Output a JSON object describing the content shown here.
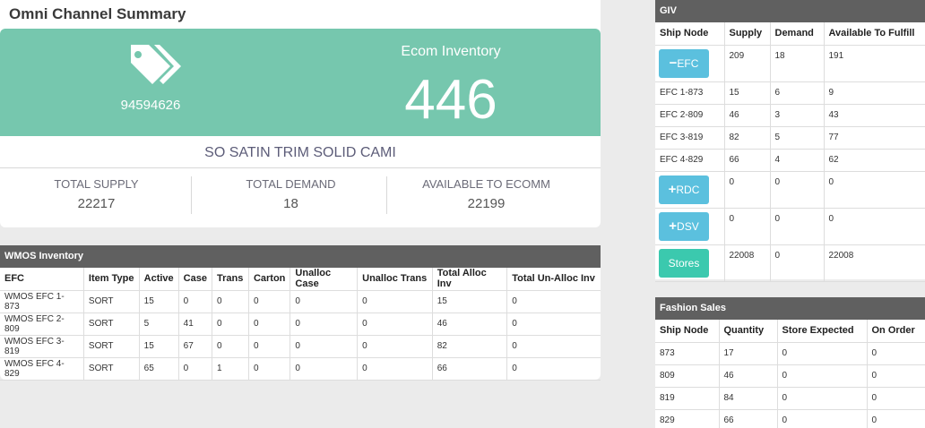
{
  "summary": {
    "title": "Omni Channel Summary",
    "item_number": "94594626",
    "ecom_label": "Ecom Inventory",
    "ecom_value": "446",
    "product_name": "SO SATIN TRIM SOLID CAMI",
    "stats": [
      {
        "label": "TOTAL SUPPLY",
        "value": "22217"
      },
      {
        "label": "TOTAL DEMAND",
        "value": "18"
      },
      {
        "label": "AVAILABLE TO ECOMM",
        "value": "22199"
      }
    ],
    "hero_color": "#76c7ae"
  },
  "wmos": {
    "title": "WMOS Inventory",
    "headers": [
      "EFC",
      "Item Type",
      "Active",
      "Case",
      "Trans",
      "Carton",
      "Unalloc Case",
      "Unalloc Trans",
      "Total Alloc Inv",
      "Total Un-Alloc Inv"
    ],
    "rows": [
      [
        "WMOS EFC 1-873",
        "SORT",
        "15",
        "0",
        "0",
        "0",
        "0",
        "0",
        "15",
        "0"
      ],
      [
        "WMOS EFC 2-809",
        "SORT",
        "5",
        "41",
        "0",
        "0",
        "0",
        "0",
        "46",
        "0"
      ],
      [
        "WMOS EFC 3-819",
        "SORT",
        "15",
        "67",
        "0",
        "0",
        "0",
        "0",
        "82",
        "0"
      ],
      [
        "WMOS EFC 4-829",
        "SORT",
        "65",
        "0",
        "1",
        "0",
        "0",
        "0",
        "66",
        "0"
      ]
    ]
  },
  "giv": {
    "title": "GIV",
    "headers": [
      "Ship Node",
      "Supply",
      "Demand",
      "Available To Fulfill"
    ],
    "efc_button": {
      "symbol": "−",
      "label": "EFC"
    },
    "efc_row": [
      "209",
      "18",
      "191"
    ],
    "efc_rows": [
      [
        "EFC 1-873",
        "15",
        "6",
        "9"
      ],
      [
        "EFC 2-809",
        "46",
        "3",
        "43"
      ],
      [
        "EFC 3-819",
        "82",
        "5",
        "77"
      ],
      [
        "EFC 4-829",
        "66",
        "4",
        "62"
      ]
    ],
    "rdc_button": {
      "symbol": "+",
      "label": "RDC"
    },
    "rdc_row": [
      "0",
      "0",
      "0"
    ],
    "dsv_button": {
      "symbol": "+",
      "label": "DSV"
    },
    "dsv_row": [
      "0",
      "0",
      "0"
    ],
    "stores_button": {
      "label": "Stores"
    },
    "stores_row": [
      "22008",
      "0",
      "22008"
    ]
  },
  "fashion": {
    "title": "Fashion Sales",
    "headers": [
      "Ship Node",
      "Quantity",
      "Store Expected",
      "On Order"
    ],
    "rows": [
      [
        "873",
        "17",
        "0",
        "0"
      ],
      [
        "809",
        "46",
        "0",
        "0"
      ],
      [
        "819",
        "84",
        "0",
        "0"
      ],
      [
        "829",
        "66",
        "0",
        "0"
      ]
    ]
  }
}
